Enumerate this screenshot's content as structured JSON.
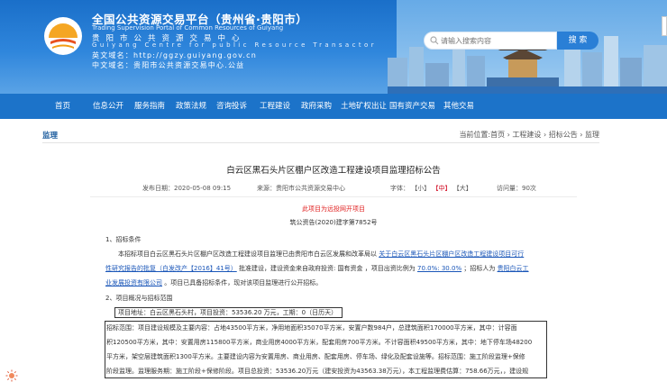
{
  "header": {
    "title": "全国公共资源交易平台（贵州省·贵阳市）",
    "subtitle_en": "Trading Supervision Portal of Common Resources of Guiyang",
    "center_cn": "贵阳市公共资源交易中心",
    "center_en": "Guiyang Centre for public Resource Transactor",
    "domain_line": "英文域名：http://ggzy.guiyang.gov.cn",
    "cn_domain_line": "中文域名：贵阳市公共资源交易中心.公益"
  },
  "search": {
    "placeholder": "请输入搜索内容",
    "button": "搜 索"
  },
  "nav": [
    "首页",
    "信息公开",
    "服务指南",
    "政策法规",
    "咨询投诉",
    "工程建设",
    "政府采购",
    "土地矿权出让",
    "国有资产交易",
    "其他交易"
  ],
  "breadcrumb": {
    "section": "监理",
    "trail": "当前位置:首页 › 工程建设 › 招标公告 › 监理"
  },
  "article": {
    "title": "白云区黑石头片区棚户区改造工程建设项目监理招标公告",
    "date": "发布日期：2020-05-08 09:15",
    "source": "来源：贵阳市公共资源交易中心",
    "font_label": "字体：",
    "font_small": "【小】",
    "font_medium": "【中】",
    "font_large": "【大】",
    "visits": "访问量：90次",
    "notice": "此项目为远投网开项目",
    "doc_no": "筑公资告(2020)建字第7852号",
    "s1_heading": "1、招标条件",
    "s1_l1a": "本招标项目白云区黑石头片区棚户区改造工程建设项目监理已由贵阳市白云区发展和改革局以",
    "s1_l1b": "关于白云区黑石头片区棚户区改造工程建设项目可行",
    "s1_l2a": "性研究报告的批复（白发改产【2016】41号）",
    "s1_l2b": "批准建设，建设资金来自政府投资: 国有资金",
    "s1_l2c": "，项目出资比例为",
    "s1_l2d": "70.0%: 30.0%",
    "s1_l2e": "；招标人为",
    "s1_l2f": "贵阳白云工",
    "s1_l3a": "业发展投资有限公司",
    "s1_l3b": "。项目已具备招标条件，现对该项目监理进行公开招标。",
    "s2_heading": "2、项目概况与招标范围",
    "s2_l1": "项目地址：白云区黑石头村，项目投资：53536.20 万元，工期：0（日历天）",
    "s2_l2": "招标范围：项目建设规模及主要内容：占地43500平方米，净用地面积35070平方米，安置户数984户，总建筑面积170000平方米，其中：计容面",
    "s2_l3": "积120500平方米，其中：安置用房115800平方米，商业用房4000平方米，配套用房700平方米。不计容面积49500平方米，其中：地下停车场48200",
    "s2_l4": "平方米，架空层建筑面积1300平方米。主要建设内容为安置用房、商业用房、配套用房、停车场、绿化及配套设施等。招标范围：施工阶段监理+保修",
    "s2_l5": "阶段监理。监理服务期：施工阶段+保修阶段。项目总投资：53536.20万元（建安投资为43563.38万元），本工程监理费估算：758.66万元，，建设规"
  }
}
